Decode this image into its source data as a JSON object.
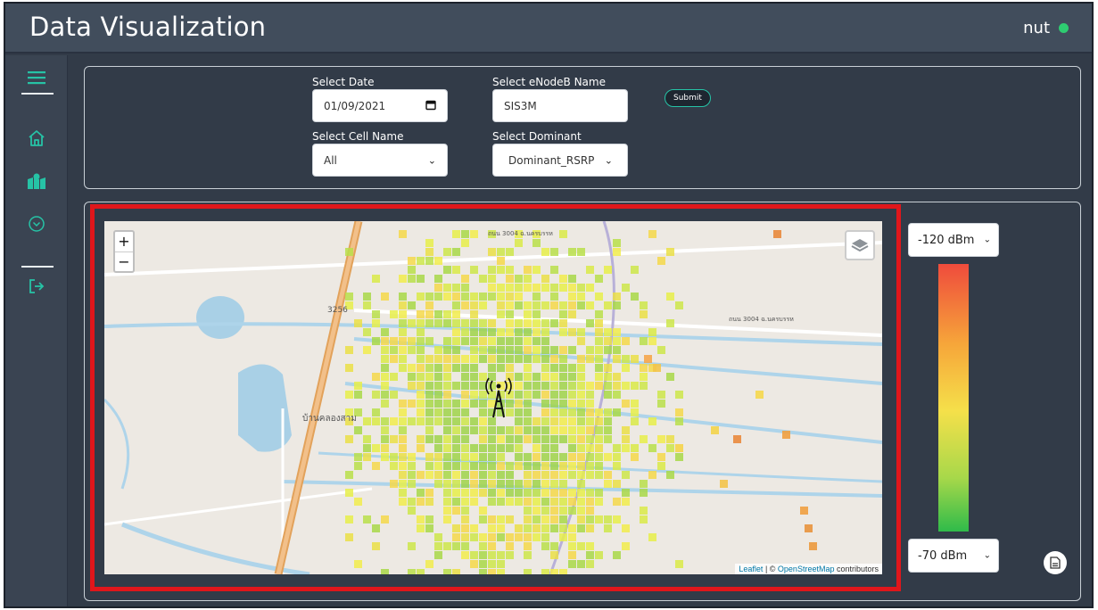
{
  "header": {
    "title": "Data Visualization",
    "user": "nut",
    "status_color": "#2ecc71"
  },
  "sidebar": {
    "accent": "#26c3a6",
    "items": [
      {
        "icon": "menu-icon"
      },
      {
        "icon": "home-icon"
      },
      {
        "icon": "map-icon"
      },
      {
        "icon": "chevron-circle-icon"
      },
      {
        "icon": "logout-icon"
      }
    ]
  },
  "filters": {
    "date_label": "Select Date",
    "date_value": "01/09/2021",
    "enodeb_label": "Select eNodeB Name",
    "enodeb_value": "SIS3M",
    "cell_label": "Select Cell Name",
    "cell_value": "All",
    "dominant_label": "Select Dominant",
    "dominant_value": "Dominant_RSRP",
    "submit_label": "Submit"
  },
  "map": {
    "zoom_in": "+",
    "zoom_out": "−",
    "attribution_leaflet": "Leaflet",
    "attribution_sep": " | © ",
    "attribution_osm": "OpenStreetMap",
    "attribution_rest": " contributors",
    "road_label_1": "3256",
    "place_label": "บ้านคลองสาม",
    "road_label_top": "ถนน 3004 ฉ.นครบรรห",
    "road_label_right": "ถนน 3004 ฉ.นครบรรห"
  },
  "legend": {
    "max_value": "-120 dBm",
    "min_value": "-70 dBm",
    "gradient_top": "#ef4b3c",
    "gradient_bottom": "#2fbb4a"
  },
  "highlight_color": "#e0161b"
}
